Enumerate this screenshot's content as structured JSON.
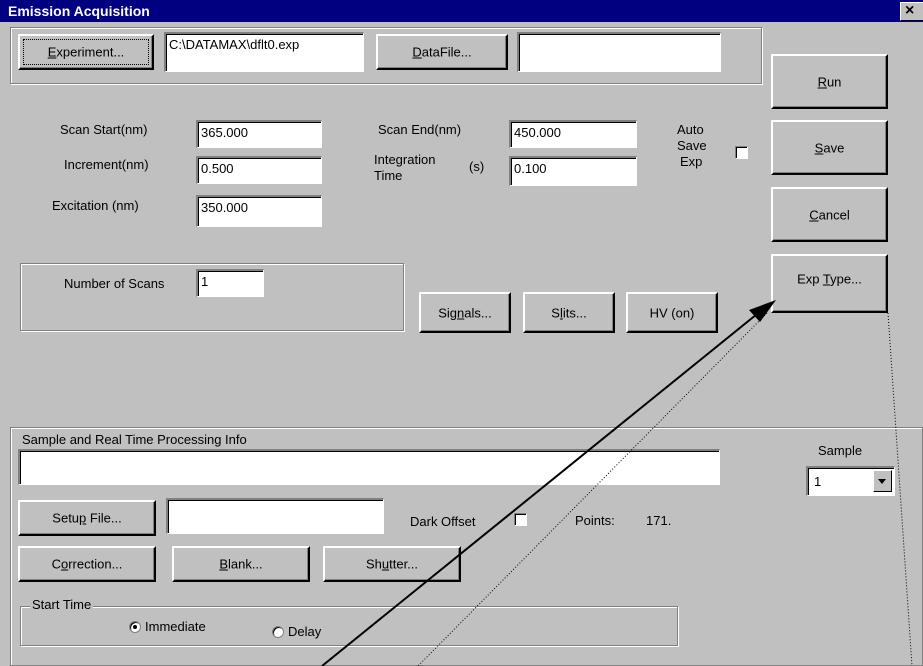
{
  "window": {
    "title": "Emission Acquisition",
    "close_glyph": "×"
  },
  "top": {
    "experiment_btn": {
      "pre": "",
      "mn": "E",
      "post": "xperiment..."
    },
    "experiment_path": "C:\\DATAMAX\\dflt0.exp",
    "datafile_btn": {
      "pre": "",
      "mn": "D",
      "post": "ataFile..."
    },
    "datafile_value": ""
  },
  "params": {
    "scan_start_label": "Scan Start(nm)",
    "scan_start_value": "365.000",
    "increment_label": "Increment(nm)",
    "increment_value": "0.500",
    "excitation_label": "Excitation (nm)",
    "excitation_value": "350.000",
    "scan_end_label": "Scan End(nm)",
    "scan_end_value": "450.000",
    "integration_label_1": "Integration",
    "integration_label_2": "Time",
    "integration_unit": "(s)",
    "integration_value": "0.100",
    "autosave_l1": "Auto",
    "autosave_l2": "Save",
    "autosave_l3": "Exp",
    "autosave_checked": false
  },
  "scans": {
    "label": "Number of Scans",
    "value": "1"
  },
  "mid_buttons": {
    "signals": {
      "pre": "Sig",
      "mn": "n",
      "post": "als..."
    },
    "slits": {
      "pre": "S",
      "mn": "l",
      "post": "its..."
    },
    "hv": {
      "pre": "HV (on)",
      "mn": "",
      "post": ""
    }
  },
  "right_buttons": {
    "run": {
      "pre": "",
      "mn": "R",
      "post": "un"
    },
    "save": {
      "pre": "",
      "mn": "S",
      "post": "ave"
    },
    "cancel": {
      "pre": "",
      "mn": "C",
      "post": "ancel"
    },
    "exptype": {
      "pre": "Exp ",
      "mn": "T",
      "post": "ype..."
    }
  },
  "sample_group": {
    "title": "Sample and Real Time Processing Info",
    "info_value": "",
    "sample_label": "Sample",
    "sample_selected": "1",
    "setup_btn": {
      "pre": "Setu",
      "mn": "p",
      "post": " File..."
    },
    "setup_value": "",
    "dark_offset_label": "Dark Offset",
    "dark_offset_checked": false,
    "points_label": "Points:",
    "points_value": "171.",
    "correction_btn": {
      "pre": "C",
      "mn": "o",
      "post": "rrection..."
    },
    "blank_btn": {
      "pre": "",
      "mn": "B",
      "post": "lank..."
    },
    "shutter_btn": {
      "pre": "Sh",
      "mn": "u",
      "post": "tter..."
    }
  },
  "start_time": {
    "title": "Start Time",
    "immediate_label": "Immediate",
    "delay_label": "Delay",
    "selected": "Immediate"
  },
  "icons": {
    "dropdown": "dropdown-arrow-icon",
    "close": "close-icon"
  }
}
